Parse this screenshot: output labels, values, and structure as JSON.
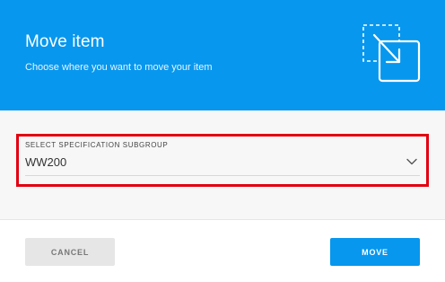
{
  "dialog": {
    "title": "Move item",
    "subtitle": "Choose where you want to move your item",
    "header_icon": "move-to-folder-icon"
  },
  "field": {
    "label": "SELECT SPECIFICATION SUBGROUP",
    "value": "WW200",
    "dropdown_icon": "chevron-down-icon"
  },
  "actions": {
    "cancel_label": "CANCEL",
    "move_label": "MOVE"
  },
  "colors": {
    "header_background": "#0797ee",
    "primary_button": "#0797ee",
    "highlight_border": "#e1000f",
    "cancel_button": "#e6e6e6"
  }
}
